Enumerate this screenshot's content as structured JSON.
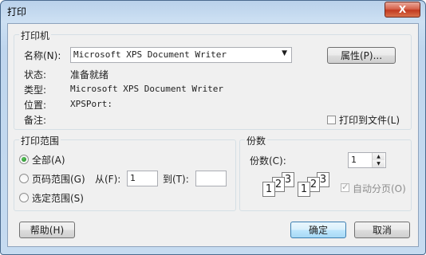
{
  "window": {
    "title": "打印",
    "close_glyph": "X"
  },
  "printer_group": {
    "legend": "打印机",
    "name_label": "名称(N):",
    "name_value": "Microsoft XPS Document Writer",
    "properties_button": "属性(P)...",
    "status_label": "状态:",
    "status_value": "准备就绪",
    "type_label": "类型:",
    "type_value": "Microsoft XPS Document Writer",
    "location_label": "位置:",
    "location_value": "XPSPort:",
    "comment_label": "备注:",
    "print_to_file_label": "打印到文件(L)",
    "print_to_file_checked": false
  },
  "range_group": {
    "legend": "打印范围",
    "all_label": "全部(A)",
    "pages_label": "页码范围(G)",
    "from_label": "从(F):",
    "from_value": "1",
    "to_label": "到(T):",
    "to_value": "",
    "selection_label": "选定范围(S)",
    "selected": "all"
  },
  "copies_group": {
    "legend": "份数",
    "copies_label": "份数(C):",
    "copies_value": "1",
    "collate_label": "自动分页(O)",
    "collate_checked": true,
    "collate_enabled": false,
    "page_icons": [
      "1",
      "2",
      "3"
    ]
  },
  "buttons": {
    "help": "帮助(H)",
    "ok": "确定",
    "cancel": "取消"
  },
  "icons": {
    "dropdown": "chevron-down-icon",
    "spin_up": "triangle-up-icon",
    "spin_down": "triangle-down-icon"
  }
}
